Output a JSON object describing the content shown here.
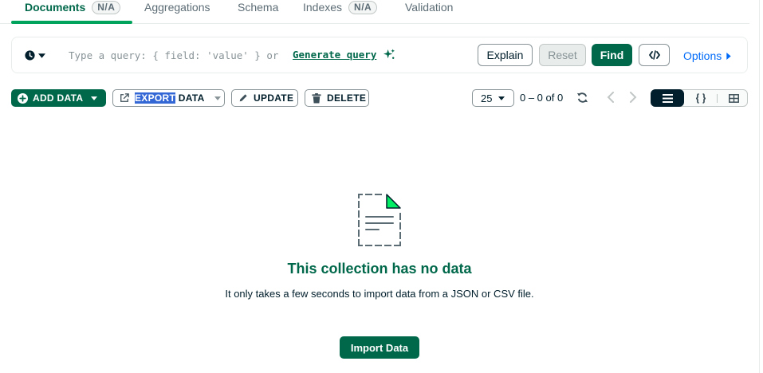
{
  "tabs": [
    {
      "label": "Documents",
      "badge": "N/A",
      "active": true
    },
    {
      "label": "Aggregations"
    },
    {
      "label": "Schema"
    },
    {
      "label": "Indexes",
      "badge": "N/A"
    },
    {
      "label": "Validation"
    }
  ],
  "query": {
    "placeholder": "Type a query: { field: 'value' } or",
    "generate_link": "Generate query",
    "explain_label": "Explain",
    "reset_label": "Reset",
    "find_label": "Find",
    "options_label": "Options"
  },
  "toolbar": {
    "add_data_label": "ADD DATA",
    "export_selected": "EXPORT",
    "export_rest": " DATA",
    "update_label": "UPDATE",
    "delete_label": "DELETE",
    "page_size": "25",
    "range_text": "0 – 0 of 0"
  },
  "empty_state": {
    "title": "This collection has no data",
    "description": "It only takes a few seconds to import data from a JSON or CSV file.",
    "import_label": "Import Data"
  },
  "colors": {
    "brand_green": "#00684a",
    "accent_green": "#00a35c",
    "link_blue": "#016bf8",
    "dark": "#001e2b"
  }
}
